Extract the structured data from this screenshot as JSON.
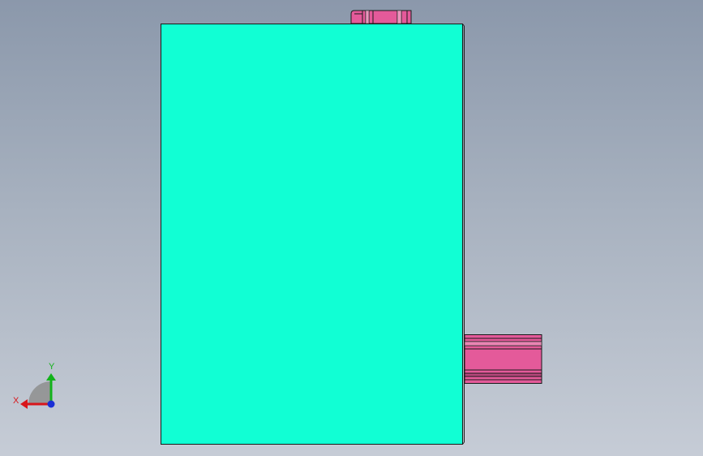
{
  "viewport": {
    "background_top": "#8b98ab",
    "background_bottom": "#c6ccd6"
  },
  "model": {
    "main_body_color": "#11ffd4",
    "feature_color": "#e45a9a",
    "edge_color": "#1a1a1a"
  },
  "triad": {
    "x_label": "X",
    "y_label": "Y",
    "x_color": "#d8161b",
    "y_color": "#13b21b",
    "z_color": "#1a2fd6"
  }
}
